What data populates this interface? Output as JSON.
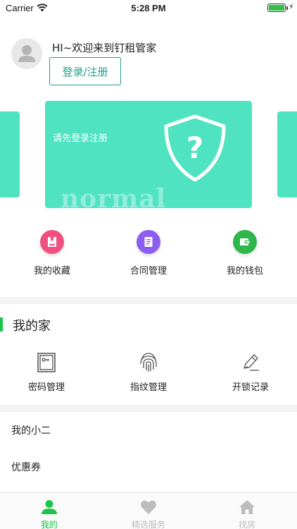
{
  "status_bar": {
    "carrier": "Carrier",
    "time": "5:28 PM",
    "icons": [
      "wifi-icon",
      "battery-icon",
      "charging-icon"
    ]
  },
  "profile": {
    "greeting": "HI~欢迎来到钉租管家",
    "login_button": "登录/注册",
    "avatar_icon": "user-avatar-icon"
  },
  "banner": {
    "text": "请先登录注册",
    "watermark": "normal",
    "icon": "shield-question-icon",
    "color": "#4fe3c2"
  },
  "quick_actions": [
    {
      "label": "我的收藏",
      "icon": "bookmark-icon",
      "color": "#f0507f"
    },
    {
      "label": "合同管理",
      "icon": "document-icon",
      "color": "#8c5ef0"
    },
    {
      "label": "我的钱包",
      "icon": "wallet-icon",
      "color": "#2fb64a"
    }
  ],
  "home_section": {
    "title": "我的家",
    "items": [
      {
        "label": "密码管理",
        "icon": "keypad-lock-icon"
      },
      {
        "label": "指纹管理",
        "icon": "fingerprint-icon"
      },
      {
        "label": "开锁记录",
        "icon": "pencil-record-icon"
      }
    ]
  },
  "list": [
    {
      "label": "我的小二"
    },
    {
      "label": "优惠券"
    }
  ],
  "tab_bar": [
    {
      "label": "我的",
      "icon": "person-icon",
      "active": true
    },
    {
      "label": "精选服务",
      "icon": "heart-icon",
      "active": false
    },
    {
      "label": "找房",
      "icon": "house-icon",
      "active": false
    }
  ],
  "colors": {
    "accent": "#1ec34a",
    "teal": "#1f9e8c",
    "card": "#4fe3c2"
  }
}
